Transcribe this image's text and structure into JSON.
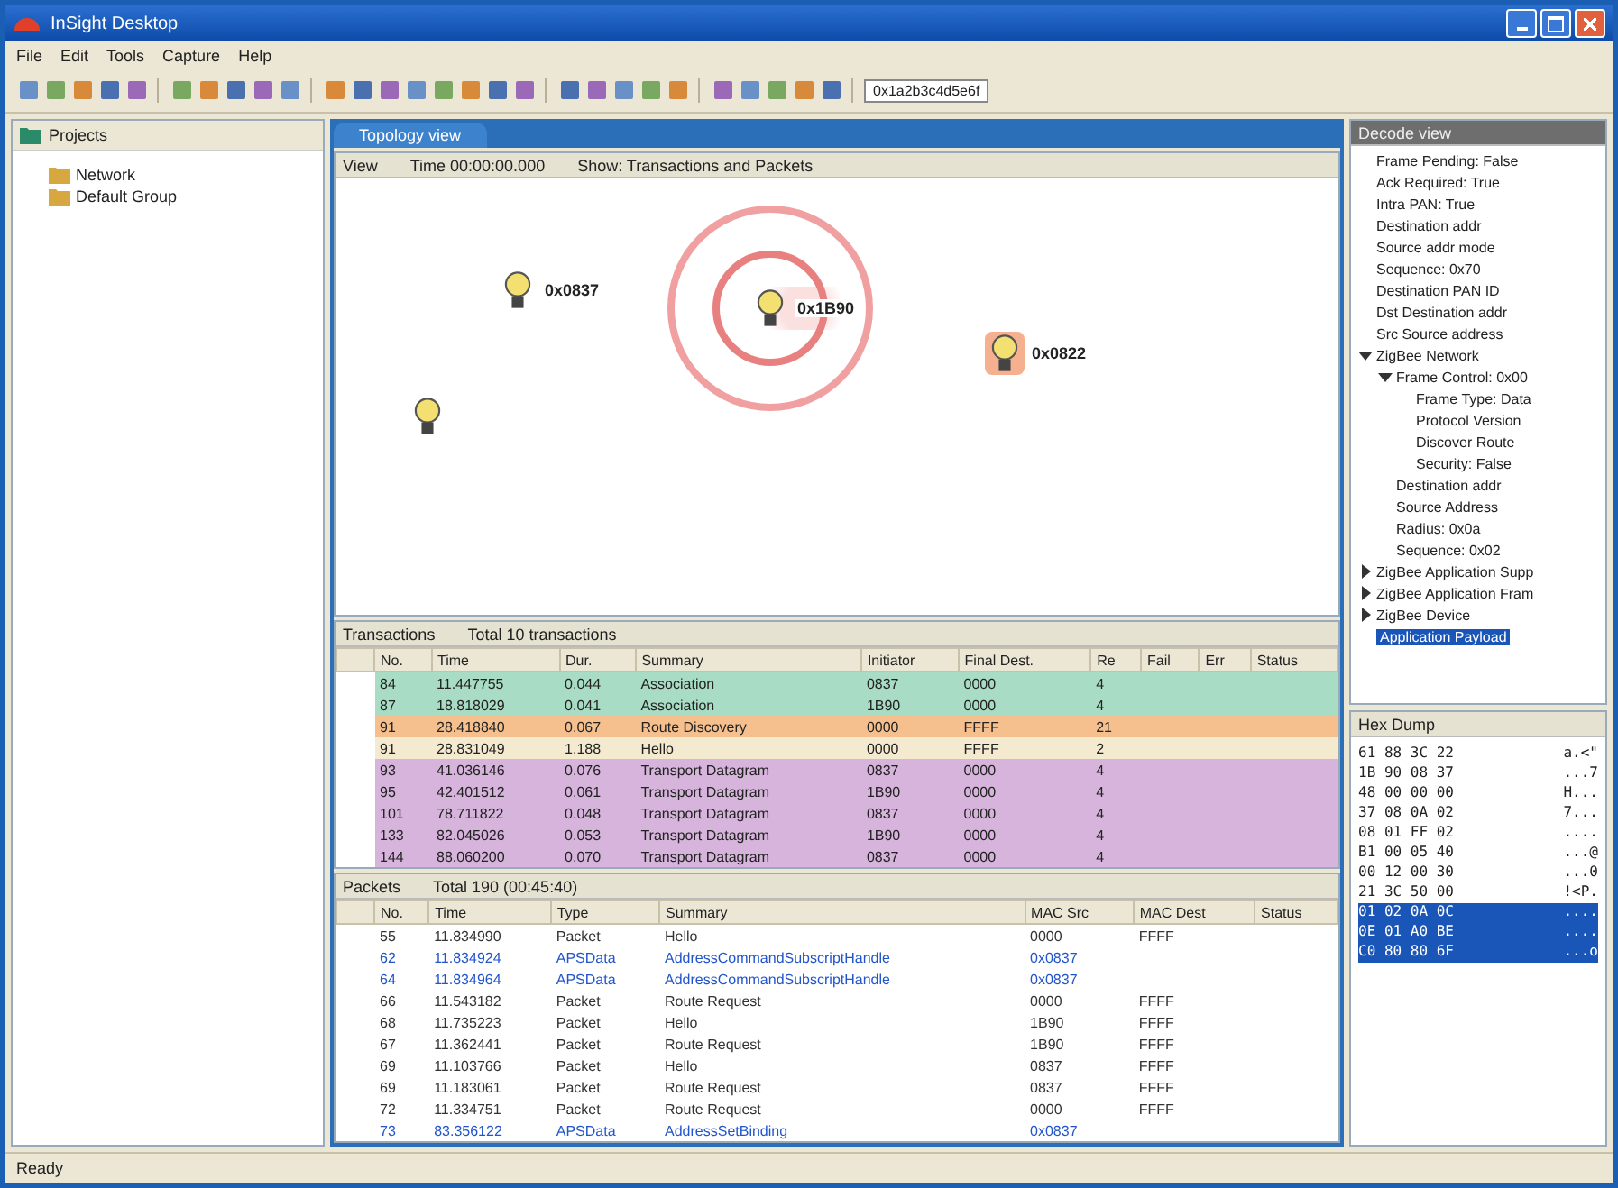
{
  "window": {
    "title": "InSight Desktop"
  },
  "menu": [
    "File",
    "Edit",
    "Tools",
    "Capture",
    "Help"
  ],
  "toolbar_field": {
    "value": "0x1a2b3c4d5e6f"
  },
  "projects": {
    "title": "Projects",
    "items": [
      {
        "label": "Network"
      },
      {
        "label": "Default Group"
      }
    ]
  },
  "view_tab": {
    "label": "Topology view"
  },
  "topology": {
    "header": [
      "View",
      "Time 00:00:00.000",
      "Show: Transactions and Packets"
    ],
    "nodes": [
      {
        "label": "0x0837",
        "transmitting": false,
        "selected": false
      },
      {
        "label": "0x1B90",
        "transmitting": true,
        "selected": false
      },
      {
        "label": "0x0822",
        "transmitting": false,
        "selected": true
      },
      {
        "transmitting": false,
        "selected": false
      }
    ]
  },
  "transactions": {
    "title": "Transactions",
    "subtitle": "Total 10 transactions",
    "columns": [
      "No.",
      "Time",
      "Dur.",
      "Summary",
      "Initiator",
      "Final Dest.",
      "Re",
      "Fail",
      "Err",
      "Status"
    ],
    "rows": [
      {
        "cells": [
          "84",
          "11.447755",
          "0.044",
          "Association",
          "0837",
          "0000",
          "4"
        ],
        "color": "#a9dcc4"
      },
      {
        "cells": [
          "87",
          "18.818029",
          "0.041",
          "Association",
          "1B90",
          "0000",
          "4"
        ],
        "color": "#a9dcc4"
      },
      {
        "cells": [
          "91",
          "28.418840",
          "0.067",
          "Route Discovery",
          "0000",
          "FFFF",
          "21"
        ],
        "color": "#f5c08e"
      },
      {
        "cells": [
          "91",
          "28.831049",
          "1.188",
          "Hello",
          "0000",
          "FFFF",
          "2"
        ],
        "color": "#f3ead0"
      },
      {
        "cells": [
          "93",
          "41.036146",
          "0.076",
          "Transport Datagram",
          "0837",
          "0000",
          "4"
        ],
        "color": "#d6b4dc"
      },
      {
        "cells": [
          "95",
          "42.401512",
          "0.061",
          "Transport Datagram",
          "1B90",
          "0000",
          "4"
        ],
        "color": "#d6b4dc"
      },
      {
        "cells": [
          "101",
          "78.711822",
          "0.048",
          "Transport Datagram",
          "0837",
          "0000",
          "4"
        ],
        "color": "#d6b4dc"
      },
      {
        "cells": [
          "133",
          "82.045026",
          "0.053",
          "Transport Datagram",
          "1B90",
          "0000",
          "4"
        ],
        "color": "#d6b4dc"
      },
      {
        "cells": [
          "144",
          "88.060200",
          "0.070",
          "Transport Datagram",
          "0837",
          "0000",
          "4"
        ],
        "color": "#d6b4dc"
      }
    ]
  },
  "packets": {
    "title": "Packets",
    "subtitle": "Total 190 (00:45:40)",
    "columns": [
      "No.",
      "Time",
      "Type",
      "Summary",
      "MAC Src",
      "MAC Dest",
      "Status"
    ],
    "rows": [
      {
        "cells": [
          "55",
          "11.834990",
          "Packet",
          "Hello",
          "0000",
          "FFFF"
        ],
        "color": "#333333"
      },
      {
        "cells": [
          "62",
          "11.834924",
          "APSData",
          "AddressCommandSubscriptHandle",
          "0x0837",
          ""
        ],
        "color": "#2255cc"
      },
      {
        "cells": [
          "64",
          "11.834964",
          "APSData",
          "AddressCommandSubscriptHandle",
          "0x0837",
          ""
        ],
        "color": "#2255cc"
      },
      {
        "cells": [
          "66",
          "11.543182",
          "Packet",
          "Route Request",
          "0000",
          "FFFF"
        ],
        "color": "#333333"
      },
      {
        "cells": [
          "68",
          "11.735223",
          "Packet",
          "Hello",
          "1B90",
          "FFFF"
        ],
        "color": "#333333"
      },
      {
        "cells": [
          "67",
          "11.362441",
          "Packet",
          "Route Request",
          "1B90",
          "FFFF"
        ],
        "color": "#333333"
      },
      {
        "cells": [
          "69",
          "11.103766",
          "Packet",
          "Hello",
          "0837",
          "FFFF"
        ],
        "color": "#333333"
      },
      {
        "cells": [
          "69",
          "11.183061",
          "Packet",
          "Route Request",
          "0837",
          "FFFF"
        ],
        "color": "#333333"
      },
      {
        "cells": [
          "72",
          "11.334751",
          "Packet",
          "Route Request",
          "0000",
          "FFFF"
        ],
        "color": "#333333"
      },
      {
        "cells": [
          "73",
          "83.356122",
          "APSData",
          "AddressSetBinding",
          "0x0837",
          ""
        ],
        "color": "#2255cc"
      }
    ]
  },
  "decode": {
    "title": "Decode view",
    "tree": [
      {
        "label": "Frame Pending: False",
        "selected": false
      },
      {
        "label": "Ack Required: True",
        "selected": false
      },
      {
        "label": "Intra PAN: True",
        "selected": false
      },
      {
        "label": "Destination addr",
        "selected": false
      },
      {
        "label": "Source addr mode",
        "selected": false
      },
      {
        "label": "Sequence: 0x70",
        "selected": false
      },
      {
        "label": "Destination PAN ID",
        "selected": false
      },
      {
        "label": "Dst Destination addr",
        "selected": false
      },
      {
        "label": "Src Source address",
        "selected": false
      },
      {
        "label": "ZigBee Network",
        "expanded": true,
        "selected": false,
        "children": [
          {
            "label": "Frame Control: 0x00",
            "expanded": true,
            "selected": false,
            "children": [
              {
                "label": "Frame Type: Data",
                "selected": false
              },
              {
                "label": "Protocol Version",
                "selected": false
              },
              {
                "label": "Discover Route",
                "selected": false
              },
              {
                "label": "Security: False",
                "selected": false
              }
            ]
          },
          {
            "label": "Destination addr",
            "selected": false
          },
          {
            "label": "Source Address",
            "selected": false
          },
          {
            "label": "Radius: 0x0a",
            "selected": false
          },
          {
            "label": "Sequence: 0x02",
            "selected": false
          }
        ]
      },
      {
        "label": "ZigBee Application Supp",
        "expanded": false,
        "selected": false
      },
      {
        "label": "ZigBee Application Fram",
        "expanded": false,
        "selected": false
      },
      {
        "label": "ZigBee Device",
        "expanded": false,
        "selected": false
      },
      {
        "label": "Application Payload",
        "selected": true
      }
    ]
  },
  "hex": {
    "title": "Hex Dump",
    "rows": [
      {
        "bytes": [
          "61",
          "88",
          "3C",
          "22"
        ],
        "ascii": "a.<\"",
        "selected": false
      },
      {
        "bytes": [
          "1B",
          "90",
          "08",
          "37"
        ],
        "ascii": "...7",
        "selected": false
      },
      {
        "bytes": [
          "48",
          "00",
          "00",
          "00"
        ],
        "ascii": "H...",
        "selected": false
      },
      {
        "bytes": [
          "37",
          "08",
          "0A",
          "02"
        ],
        "ascii": "7...",
        "selected": false
      },
      {
        "bytes": [
          "08",
          "01",
          "FF",
          "02"
        ],
        "ascii": "....",
        "selected": false
      },
      {
        "bytes": [
          "B1",
          "00",
          "05",
          "40"
        ],
        "ascii": "...@",
        "selected": false
      },
      {
        "bytes": [
          "00",
          "12",
          "00",
          "30"
        ],
        "ascii": "...0",
        "selected": false
      },
      {
        "bytes": [
          "21",
          "3C",
          "50",
          "00"
        ],
        "ascii": "!<P.",
        "selected": false
      },
      {
        "bytes": [
          "01",
          "02",
          "0A",
          "0C"
        ],
        "ascii": "....",
        "selected": true
      },
      {
        "bytes": [
          "0E",
          "01",
          "A0",
          "BE"
        ],
        "ascii": "....",
        "selected": true
      },
      {
        "bytes": [
          "C0",
          "80",
          "80",
          "6F"
        ],
        "ascii": "...o",
        "selected": true
      }
    ]
  },
  "status_bar": {
    "text": "Ready"
  }
}
